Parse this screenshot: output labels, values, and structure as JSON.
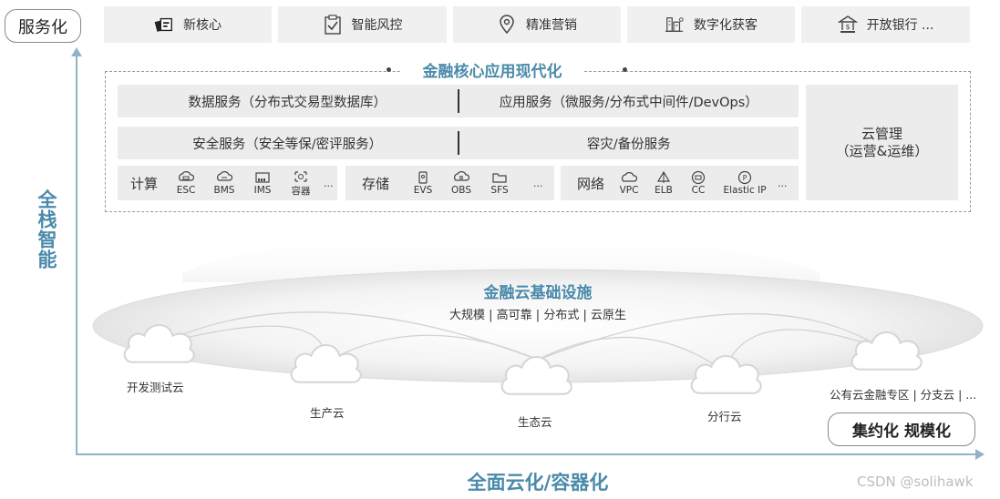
{
  "top_badge": "服务化",
  "top_bar": [
    {
      "label": "新核心",
      "icon": "card-icon"
    },
    {
      "label": "智能风控",
      "icon": "clipboard-check-icon"
    },
    {
      "label": "精准营销",
      "icon": "location-pin-icon"
    },
    {
      "label": "数字化获客",
      "icon": "building-network-icon"
    },
    {
      "label": "开放银行 ...",
      "icon": "bank-icon"
    }
  ],
  "v_axis_label": "全栈智能",
  "h_axis_label": "全面云化/容器化",
  "core": {
    "title": "金融核心应用现代化",
    "row1": {
      "left": "数据服务（分布式交易型数据库）",
      "right": "应用服务（微服务/分布式中间件/DevOps）"
    },
    "row2": {
      "left": "安全服务（安全等保/密评服务）",
      "right": "容灾/备份服务"
    },
    "mgmt_line1": "云管理",
    "mgmt_line2": "（运营&运维）",
    "compute": {
      "label": "计算",
      "items": [
        "ESC",
        "BMS",
        "IMS",
        "容器"
      ],
      "more": "..."
    },
    "storage": {
      "label": "存储",
      "items": [
        "EVS",
        "OBS",
        "SFS"
      ],
      "more": "..."
    },
    "network": {
      "label": "网络",
      "items": [
        "VPC",
        "ELB",
        "CC",
        "Elastic IP"
      ],
      "more": "..."
    }
  },
  "infra": {
    "title": "金融云基础设施",
    "subtitle": "大规模 | 高可靠 | 分布式 | 云原生",
    "clouds": [
      "开发测试云",
      "生产云",
      "生态云",
      "分行云",
      "公有云金融专区 | 分支云 | ..."
    ]
  },
  "bottom_badge": "集约化  规模化",
  "watermark": "CSDN @solihawk",
  "colors": {
    "accent": "#4a8aaa",
    "axis": "#8fb3c7",
    "panel": "#ececec"
  }
}
